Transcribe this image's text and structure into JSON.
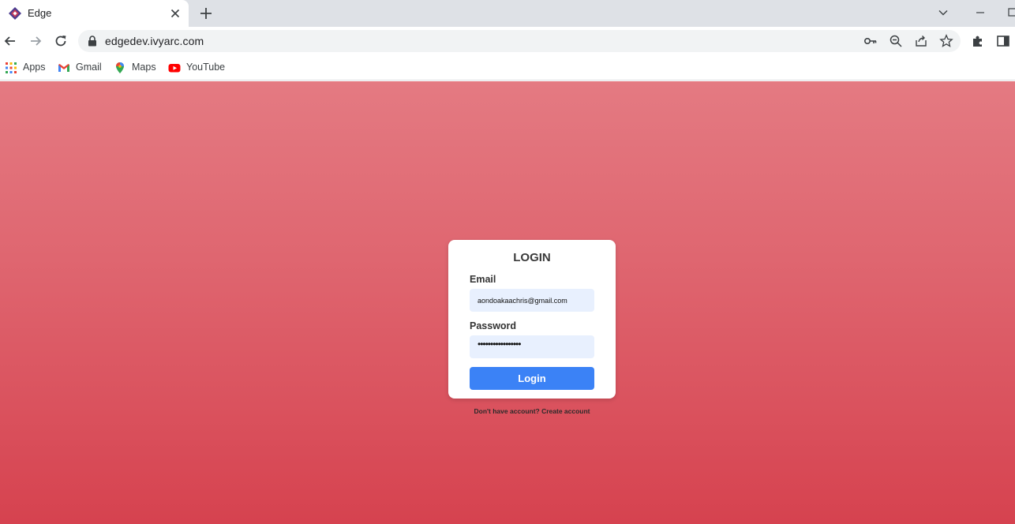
{
  "browser": {
    "tab": {
      "title": "Edge",
      "favicon": "edge-logo-icon",
      "close_icon": "close-icon"
    },
    "new_tab_icon": "plus-icon",
    "window_controls": [
      "chevron-down-icon",
      "minimize-icon",
      "restore-icon"
    ],
    "toolbar": {
      "back_icon": "back-arrow-icon",
      "forward_icon": "forward-arrow-icon",
      "reload_icon": "reload-icon",
      "url": "edgedev.ivyarc.com",
      "omnibox_icons": [
        "key-icon",
        "zoom-icon",
        "share-icon",
        "star-icon"
      ],
      "extension_icons": [
        "puzzle-icon",
        "side-panel-icon"
      ]
    },
    "bookmarks": [
      {
        "label": "Apps",
        "icon": "apps-grid-icon"
      },
      {
        "label": "Gmail",
        "icon": "gmail-icon"
      },
      {
        "label": "Maps",
        "icon": "maps-pin-icon"
      },
      {
        "label": "YouTube",
        "icon": "youtube-icon"
      }
    ]
  },
  "login": {
    "title": "LOGIN",
    "email_label": "Email",
    "email_value": "aondoakaachris@gmail.com",
    "password_label": "Password",
    "password_masked": "•••••••••••••••••",
    "button_label": "Login",
    "signup_text": "Don't have account? Create account"
  },
  "colors": {
    "page_gradient_top": "#e47a82",
    "page_gradient_bottom": "#d6424f",
    "input_bg": "#e8f0fe",
    "button_bg": "#3b82f6"
  }
}
